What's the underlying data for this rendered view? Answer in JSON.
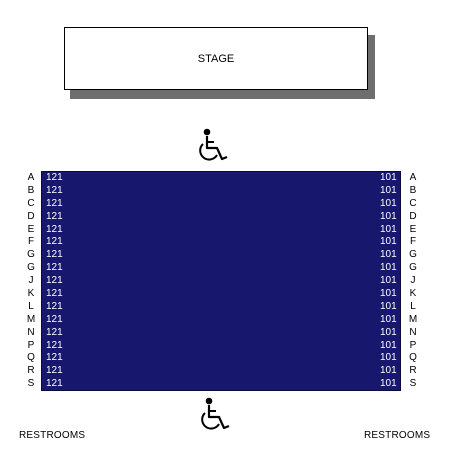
{
  "stage": {
    "label": "STAGE"
  },
  "rows": [
    "A",
    "B",
    "C",
    "D",
    "E",
    "F",
    "G",
    "G",
    "J",
    "K",
    "L",
    "M",
    "N",
    "P",
    "Q",
    "R",
    "S"
  ],
  "seats": {
    "left_number": "121",
    "right_number": "101"
  },
  "restrooms": {
    "left": "RESTROOMS",
    "right": "RESTROOMS"
  },
  "icons": {
    "accessible": "wheelchair-icon"
  },
  "colors": {
    "seating_block": "#17176e",
    "stage_shadow": "#6e6e6e"
  }
}
